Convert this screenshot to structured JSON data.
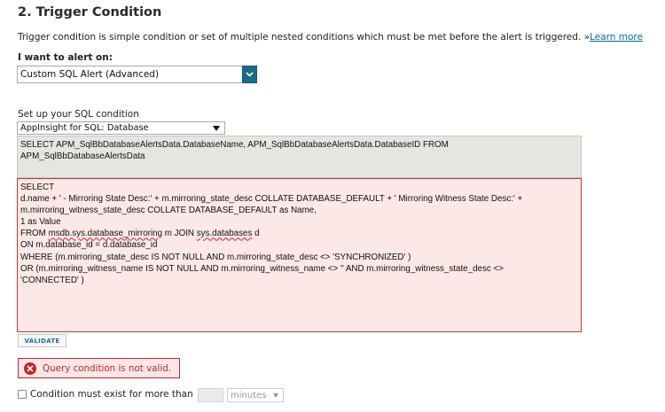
{
  "section": {
    "title": "2. Trigger Condition",
    "description": "Trigger condition is simple condition or set of multiple nested conditions which must be met before the alert is triggered. ",
    "learn_more_prefix": "»",
    "learn_more_label": "Learn more"
  },
  "alert_type": {
    "label": "I want to alert on:",
    "selected": "Custom SQL Alert (Advanced)"
  },
  "sql_condition": {
    "label": "Set up your SQL condition",
    "source_selected": "AppInsight for SQL: Database",
    "prefix_sql": "SELECT APM_SqlBbDatabaseAlertsData.DatabaseName, APM_SqlBbDatabaseAlertsData.DatabaseID FROM\nAPM_SqlBbDatabaseAlertsData",
    "editor": {
      "l1": "SELECT",
      "l2": "d.name + ' - Mirroring State Desc:' + m.mirroring_state_desc COLLATE DATABASE_DEFAULT + ' Mirroring Witness State Desc:' +",
      "l3": "m.mirroring_witness_state_desc COLLATE DATABASE_DEFAULT as Name,",
      "l4": "1 as Value",
      "l5a": "FROM ",
      "l5b": "msdb.sys.database_mirroring",
      "l5c": " m JOIN ",
      "l5d": "sys.databases",
      "l5e": " d",
      "l6": "ON m.database_id = d.database_id",
      "l7": "WHERE (m.mirroring_state_desc IS NOT NULL AND m.mirroring_state_desc <> 'SYNCHRONIZED' )",
      "l8": "OR (m.mirroring_witness_name IS NOT NULL AND m.mirroring_witness_name <> '' AND m.mirroring_witness_state_desc <>",
      "l9": "'CONNECTED' )"
    },
    "validate_label": "VALIDATE"
  },
  "error": {
    "message": "Query condition is not valid."
  },
  "duration": {
    "label": "Condition must exist for more than",
    "value": "",
    "unit_selected": "minutes"
  },
  "colors": {
    "accent_select": "#1c6a86",
    "error": "#c8262a",
    "link": "#0a6aa8"
  }
}
